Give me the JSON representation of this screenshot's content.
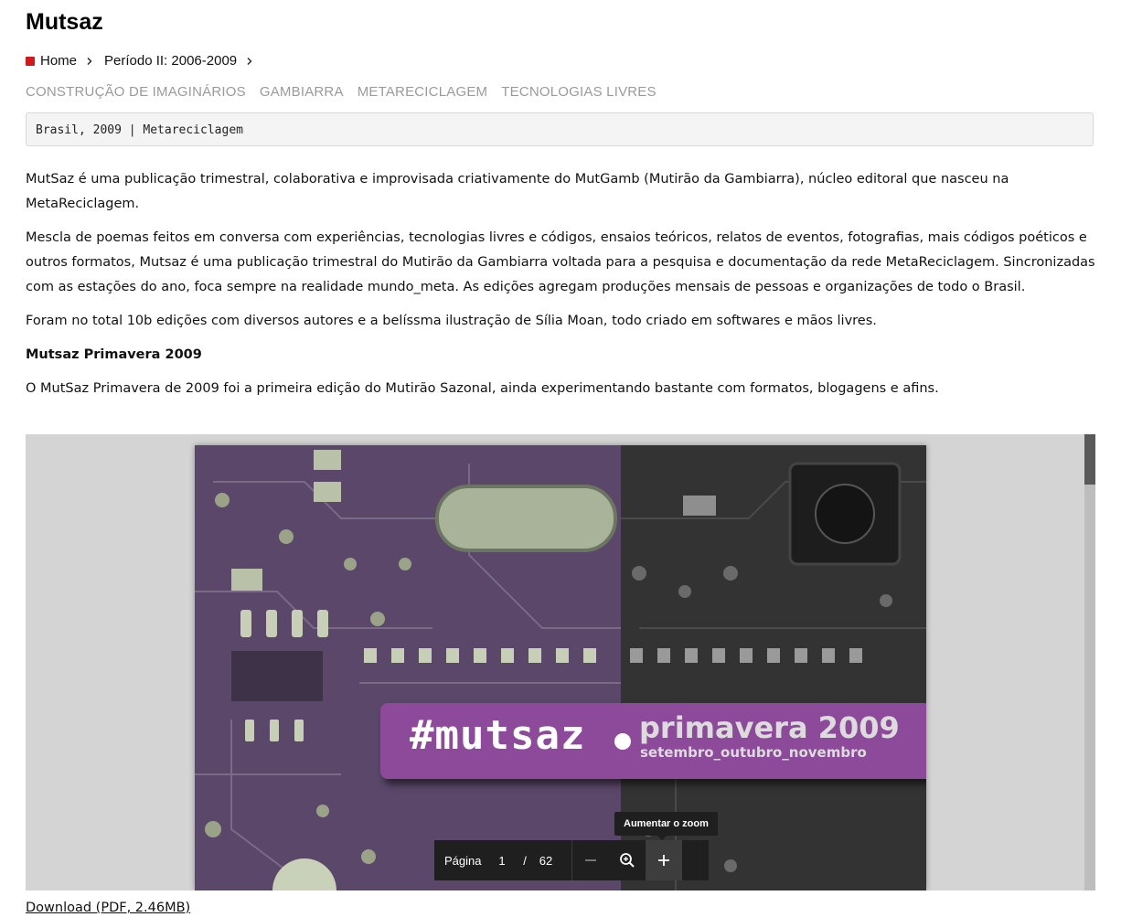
{
  "page": {
    "title": "Mutsaz"
  },
  "breadcrumb": {
    "home": "Home",
    "period": "Período II: 2006-2009"
  },
  "tags": [
    "CONSTRUÇÃO DE IMAGINÁRIOS",
    "GAMBIARRA",
    "METARECICLAGEM",
    "TECNOLOGIAS LIVRES"
  ],
  "meta": "Brasil, 2009 | Metareciclagem",
  "content": {
    "p1": "MutSaz é uma publicação trimestral, colaborativa e improvisada criativamente do MutGamb (Mutirão da Gambiarra), núcleo editoral que nasceu na MetaReciclagem.",
    "p2": "Mescla de poemas feitos em conversa com experiências, tecnologias livres e códigos, ensaios teóricos, relatos de eventos, fotografias, mais códigos poéticos e outros formatos, Mutsaz é uma publicação trimestral do Mutirão da Gambiarra voltada para a pesquisa e documentação da rede MetaReciclagem. Sincronizadas com as estações do ano, foca sempre na realidade mundo_meta. As edições agregam produções mensais de pessoas e organizações de todo o Brasil.",
    "p3": "Foram no total 10b edições com diversos autores e a belíssma ilustração de Sília Moan, todo criado em softwares e mãos livres.",
    "heading": "Mutsaz Primavera 2009",
    "p4": "O MutSaz Primavera de 2009 foi a primeira edição do Mutirão Sazonal, ainda experimentando bastante com formatos, blogagens e afins."
  },
  "viewer": {
    "cover": {
      "hashtag": "#mutsaz",
      "season": "primavera 2009",
      "months": "setembro_outubro_novembro"
    },
    "tooltip": "Aumentar o zoom",
    "toolbar": {
      "page_label": "Página",
      "current_page": "1",
      "separator": "/",
      "total_pages": "62"
    },
    "icons": {
      "zoom_out": "minus-icon",
      "zoom_fit": "magnifier-icon",
      "zoom_in": "plus-icon"
    }
  },
  "download": "Download (PDF, 2.46MB)",
  "colors": {
    "home_marker": "#d4181c",
    "banner": "#8e4a9a",
    "tag_text": "#9a9a9a"
  }
}
